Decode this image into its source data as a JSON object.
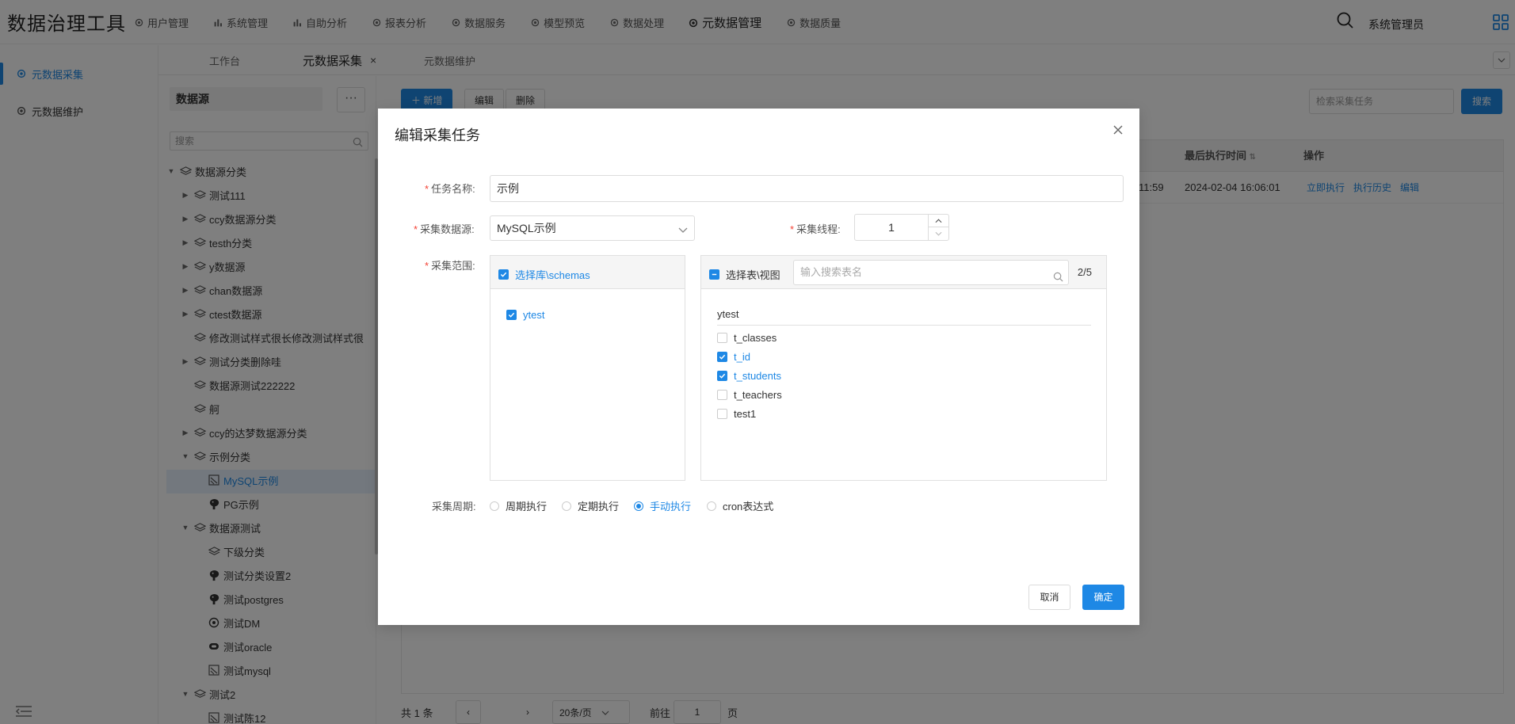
{
  "app": {
    "title": "数据治理工具",
    "user": "系统管理员"
  },
  "nav": [
    {
      "label": "用户管理",
      "icon": "gear-icon"
    },
    {
      "label": "系统管理",
      "icon": "bar-chart-icon"
    },
    {
      "label": "自助分析",
      "icon": "bar-chart-icon"
    },
    {
      "label": "报表分析",
      "icon": "gear-icon"
    },
    {
      "label": "数据服务",
      "icon": "gear-icon"
    },
    {
      "label": "模型预览",
      "icon": "gear-icon"
    },
    {
      "label": "数据处理",
      "icon": "gear-icon"
    },
    {
      "label": "元数据管理",
      "icon": "gear-icon",
      "active": true
    },
    {
      "label": "数据质量",
      "icon": "gear-icon"
    }
  ],
  "sidebar": {
    "items": [
      {
        "label": "元数据采集",
        "active": true
      },
      {
        "label": "元数据维护"
      }
    ]
  },
  "tabs": [
    {
      "label": "工作台"
    },
    {
      "label": "元数据采集",
      "active": true,
      "close": "×"
    },
    {
      "label": "元数据维护"
    }
  ],
  "datasource_panel": {
    "title": "数据源",
    "more": "···",
    "search_placeholder": "搜索",
    "tree": [
      {
        "label": "数据源分类",
        "level": 0,
        "arrow": "down",
        "icon": "layers-icon"
      },
      {
        "label": "测试111",
        "level": 1,
        "arrow": "right",
        "icon": "layers-icon"
      },
      {
        "label": "ccy数据源分类",
        "level": 1,
        "arrow": "right",
        "icon": "layers-icon"
      },
      {
        "label": "testh分类",
        "level": 1,
        "arrow": "right",
        "icon": "layers-icon"
      },
      {
        "label": "y数据源",
        "level": 1,
        "arrow": "right",
        "icon": "layers-icon"
      },
      {
        "label": "chan数据源",
        "level": 1,
        "arrow": "right",
        "icon": "layers-icon"
      },
      {
        "label": "ctest数据源",
        "level": 1,
        "arrow": "right",
        "icon": "layers-icon"
      },
      {
        "label": "修改测试样式很长修改测试样式很",
        "level": 1,
        "arrow": "none",
        "icon": "layers-icon"
      },
      {
        "label": "测试分类删除哇",
        "level": 1,
        "arrow": "right",
        "icon": "layers-icon"
      },
      {
        "label": "数据源测试222222",
        "level": 1,
        "arrow": "none",
        "icon": "layers-icon"
      },
      {
        "label": "舸",
        "level": 1,
        "arrow": "none",
        "icon": "layers-icon"
      },
      {
        "label": "ccy的达梦数据源分类",
        "level": 1,
        "arrow": "right",
        "icon": "layers-icon"
      },
      {
        "label": "示例分类",
        "level": 1,
        "arrow": "down",
        "icon": "layers-icon"
      },
      {
        "label": "MySQL示例",
        "level": 2,
        "arrow": "none",
        "icon": "mysql-icon",
        "selected": true
      },
      {
        "label": "PG示例",
        "level": 2,
        "arrow": "none",
        "icon": "postgres-icon"
      },
      {
        "label": "数据源测试",
        "level": 1,
        "arrow": "down",
        "icon": "layers-icon"
      },
      {
        "label": "下级分类",
        "level": 2,
        "arrow": "none",
        "icon": "layers-icon"
      },
      {
        "label": "测试分类设置2",
        "level": 2,
        "arrow": "none",
        "icon": "postgres-icon"
      },
      {
        "label": "测试postgres",
        "level": 2,
        "arrow": "none",
        "icon": "postgres-icon"
      },
      {
        "label": "测试DM",
        "level": 2,
        "arrow": "none",
        "icon": "dm-icon"
      },
      {
        "label": "测试oracle",
        "level": 2,
        "arrow": "none",
        "icon": "oracle-icon"
      },
      {
        "label": "测试mysql",
        "level": 2,
        "arrow": "none",
        "icon": "mysql-icon"
      },
      {
        "label": "测试2",
        "level": 1,
        "arrow": "down",
        "icon": "layers-icon"
      },
      {
        "label": "测试陈12",
        "level": 2,
        "arrow": "none",
        "icon": "mysql-icon"
      }
    ]
  },
  "toolbar": {
    "add": "新增",
    "edit": "编辑",
    "delete": "删除",
    "search_placeholder": "检索采集任务",
    "search": "搜索"
  },
  "table": {
    "headers": {
      "last_exec": "最后执行时间",
      "ops": "操作"
    },
    "rows": [
      {
        "prev_time_tail": "11:59",
        "last_exec": "2024-02-04 16:06:01",
        "ops": [
          "立即执行",
          "执行历史",
          "编辑"
        ]
      }
    ]
  },
  "pagination": {
    "total": "共 1 条",
    "page_size": "20条/页",
    "goto_label": "前往",
    "page": "1",
    "page_suffix": "页"
  },
  "modal": {
    "title": "编辑采集任务",
    "name_label": "任务名称:",
    "name_value": "示例",
    "source_label": "采集数据源:",
    "source_value": "MySQL示例",
    "threads_label": "采集线程:",
    "threads_value": "1",
    "scope_label": "采集范围:",
    "schemas": {
      "header": "选择库\\schemas",
      "items": [
        {
          "label": "ytest",
          "checked": true
        }
      ]
    },
    "tables": {
      "header": "选择表\\视图",
      "search_placeholder": "输入搜索表名",
      "count": "2/5",
      "group": "ytest",
      "items": [
        {
          "label": "t_classes",
          "checked": false
        },
        {
          "label": "t_id",
          "checked": true
        },
        {
          "label": "t_students",
          "checked": true
        },
        {
          "label": "t_teachers",
          "checked": false
        },
        {
          "label": "test1",
          "checked": false
        }
      ]
    },
    "period_label": "采集周期:",
    "periods": [
      {
        "label": "周期执行",
        "checked": false
      },
      {
        "label": "定期执行",
        "checked": false
      },
      {
        "label": "手动执行",
        "checked": true
      },
      {
        "label": "cron表达式",
        "checked": false
      }
    ],
    "cancel": "取消",
    "ok": "确定"
  },
  "colors": {
    "accent": "#1e88e5",
    "required": "#f44336",
    "overlay": "rgba(0,0,0,0.5)"
  }
}
